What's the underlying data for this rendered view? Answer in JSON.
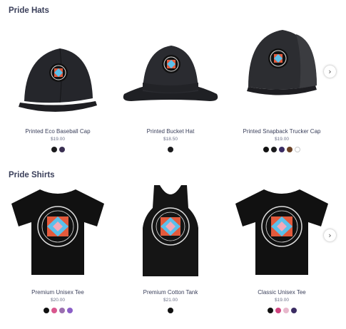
{
  "sections": [
    {
      "title": "Pride Hats",
      "products": [
        {
          "name": "Printed Eco Baseball Cap",
          "price": "$19.00",
          "image_icon": "baseball-cap-icon",
          "swatches": [
            "#1b1b1d",
            "#3a2f52"
          ]
        },
        {
          "name": "Printed Bucket Hat",
          "price": "$18.50",
          "image_icon": "bucket-hat-icon",
          "swatches": [
            "#1b1b1d"
          ]
        },
        {
          "name": "Printed Snapback Trucker Cap",
          "price": "$19.00",
          "image_icon": "trucker-cap-icon",
          "swatches": [
            "#111111",
            "#1b1b1d",
            "#3b2c63",
            "#6b4226",
            "#ffffff"
          ]
        }
      ],
      "next_icon": "chevron-right-icon"
    },
    {
      "title": "Pride Shirts",
      "products": [
        {
          "name": "Premium Unisex Tee",
          "price": "$20.00",
          "image_icon": "tshirt-icon",
          "swatches": [
            "#111111",
            "#d9578e",
            "#9a6fb0",
            "#8b5fc7"
          ]
        },
        {
          "name": "Premium Cotton Tank",
          "price": "$21.00",
          "image_icon": "tank-top-icon",
          "swatches": [
            "#111111"
          ]
        },
        {
          "name": "Classic Unisex Tee",
          "price": "$19.00",
          "image_icon": "tshirt-icon",
          "swatches": [
            "#111111",
            "#d0457f",
            "#e7b8cc",
            "#3b2c63"
          ]
        }
      ],
      "next_icon": "chevron-right-icon"
    }
  ]
}
